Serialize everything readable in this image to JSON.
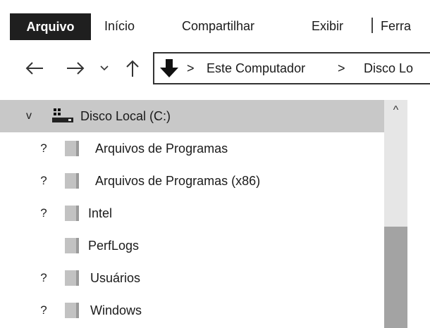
{
  "ribbon": {
    "tabs": {
      "file": "Arquivo",
      "home": "Início",
      "share": "Compartilhar",
      "view": "Exibir",
      "tools": "Ferra"
    }
  },
  "navigation": {
    "back_icon": "arrow-left-icon",
    "forward_icon": "arrow-right-icon",
    "recent_icon": "chevron-down-icon",
    "up_icon": "arrow-up-icon"
  },
  "address_bar": {
    "icon": "down-arrow-icon",
    "separator": ">",
    "segments": [
      "Este Computador",
      "Disco Lo"
    ]
  },
  "tree": {
    "root": {
      "expander": "v",
      "label": "Disco Local (C:)",
      "icon": "drive-icon",
      "selected": true
    },
    "items": [
      {
        "marker": "?",
        "label": "Arquivos de Programas"
      },
      {
        "marker": "?",
        "label": "Arquivos de Programas (x86)"
      },
      {
        "marker": "?",
        "label": "Intel"
      },
      {
        "marker": "",
        "label": "PerfLogs"
      },
      {
        "marker": "?",
        "label": "Usuários"
      },
      {
        "marker": "?",
        "label": "Windows"
      }
    ]
  },
  "scrollbar": {
    "up_arrow": "^"
  },
  "colors": {
    "file_tab_bg": "#1f1f1f",
    "selected_row_bg": "#c8c8c8",
    "scroll_track": "#e6e6e6",
    "scroll_thumb": "#a3a3a3",
    "folder_gray": "#b5b5b5"
  }
}
